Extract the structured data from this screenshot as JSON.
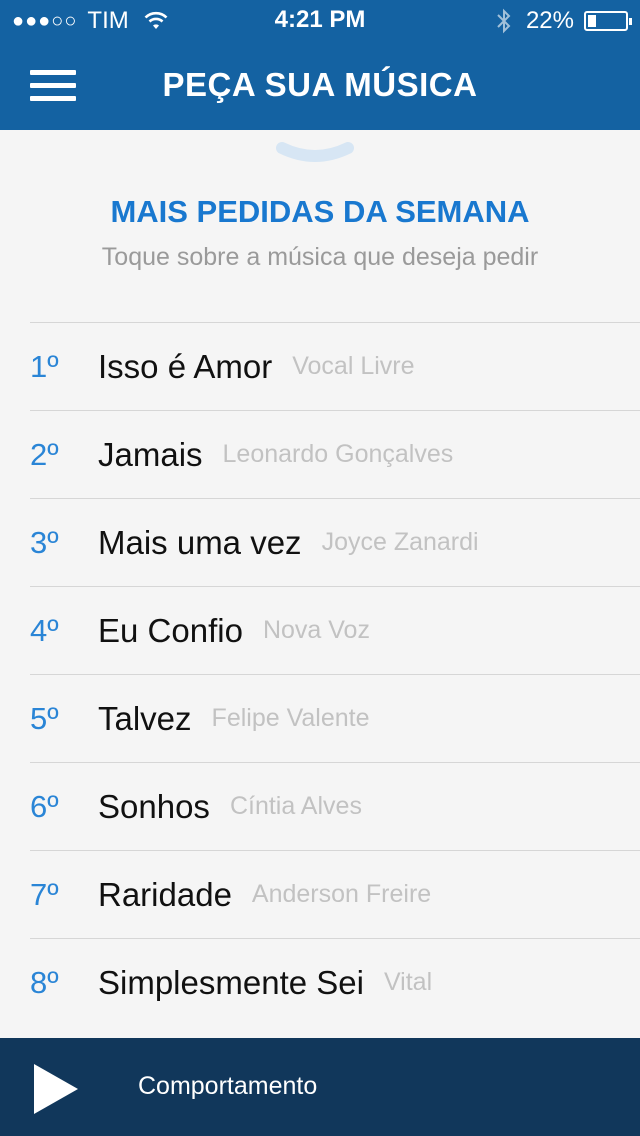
{
  "status": {
    "signal_dots": "●●●○○",
    "carrier": "TIM",
    "time": "4:21 PM",
    "battery_percent": "22%",
    "battery_level": 0.22
  },
  "header": {
    "title": "PEÇA SUA MÚSICA"
  },
  "section": {
    "title": "MAIS PEDIDAS DA SEMANA",
    "subtitle": "Toque sobre a música que deseja pedir"
  },
  "songs": [
    {
      "rank": "1º",
      "title": "Isso é Amor",
      "artist": "Vocal Livre"
    },
    {
      "rank": "2º",
      "title": "Jamais",
      "artist": "Leonardo Gonçalves"
    },
    {
      "rank": "3º",
      "title": "Mais uma vez",
      "artist": "Joyce Zanardi"
    },
    {
      "rank": "4º",
      "title": "Eu Confio",
      "artist": "Nova Voz"
    },
    {
      "rank": "5º",
      "title": "Talvez",
      "artist": "Felipe Valente"
    },
    {
      "rank": "6º",
      "title": "Sonhos",
      "artist": "Cíntia Alves"
    },
    {
      "rank": "7º",
      "title": "Raridade",
      "artist": "Anderson Freire"
    },
    {
      "rank": "8º",
      "title": "Simplesmente Sei",
      "artist": "Vital"
    }
  ],
  "player": {
    "now_playing": "Comportamento"
  },
  "colors": {
    "header_bg": "#1462a2",
    "accent": "#1978cf",
    "player_bg": "#11375b"
  }
}
